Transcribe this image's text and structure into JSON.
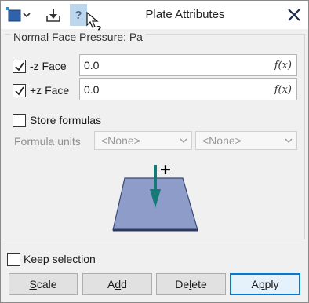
{
  "window": {
    "title": "Plate Attributes",
    "help_label": "?"
  },
  "group": {
    "title": "Normal Face Pressure: Pa"
  },
  "faces": [
    {
      "label": "-z Face",
      "checked": true,
      "value": "0.0",
      "fx": "f(x)"
    },
    {
      "label": "+z Face",
      "checked": true,
      "value": "0.0",
      "fx": "f(x)"
    }
  ],
  "store_formulas": {
    "label": "Store formulas",
    "checked": false
  },
  "formula_units": {
    "label": "Formula units",
    "first": "<None>",
    "second": "<None>"
  },
  "diagram": {
    "plus": "+"
  },
  "keep_selection": {
    "label": "Keep selection",
    "checked": false
  },
  "buttons": {
    "scale_first": "S",
    "scale_rest": "cale",
    "add_first": "A",
    "add_mid": "d",
    "add_rest": "d",
    "delete_first": "De",
    "delete_mid": "l",
    "delete_rest": "ete",
    "apply_first": "A",
    "apply_mid": "p",
    "apply_rest": "ply"
  },
  "colors": {
    "plate_fill": "#8d9cc8",
    "plate_stroke": "#3a4a78",
    "arrow": "#137a75",
    "accent": "#0078d7"
  }
}
